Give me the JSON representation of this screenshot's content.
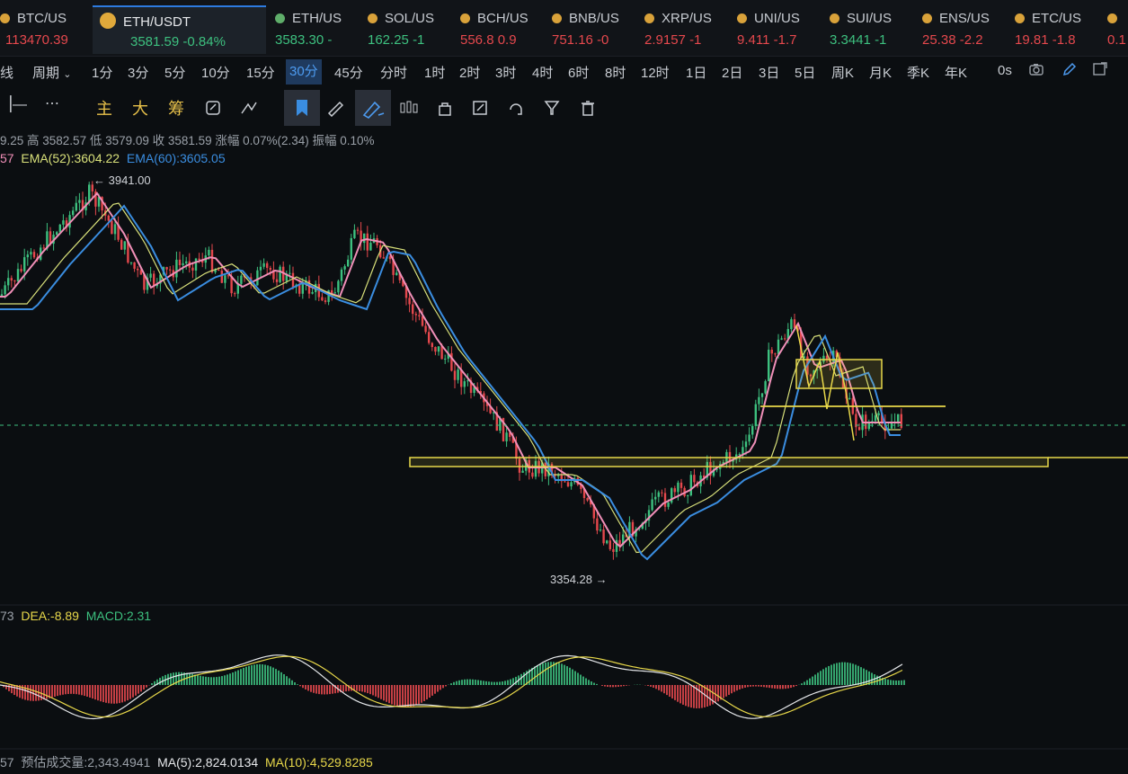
{
  "tickers": [
    {
      "symbol": "BTC/US",
      "price": "113470.39",
      "change": "",
      "dir": "down"
    },
    {
      "symbol": "ETH/USDT",
      "price": "3581.59",
      "change": "-0.84%",
      "dir": "up",
      "active": true
    },
    {
      "symbol": "ETH/US",
      "price": "3583.30",
      "change": "-",
      "dir": "up"
    },
    {
      "symbol": "SOL/US",
      "price": "162.25",
      "change": "-1",
      "dir": "up"
    },
    {
      "symbol": "BCH/US",
      "price": "556.8",
      "change": "0.9",
      "dir": "down"
    },
    {
      "symbol": "BNB/US",
      "price": "751.16",
      "change": "-0",
      "dir": "down"
    },
    {
      "symbol": "XRP/US",
      "price": "2.9157",
      "change": "-1",
      "dir": "down"
    },
    {
      "symbol": "UNI/US",
      "price": "9.411",
      "change": "-1.7",
      "dir": "down"
    },
    {
      "symbol": "SUI/US",
      "price": "3.3441",
      "change": "-1",
      "dir": "up"
    },
    {
      "symbol": "ENS/US",
      "price": "25.38",
      "change": "-2.2",
      "dir": "down"
    },
    {
      "symbol": "ETC/US",
      "price": "19.81",
      "change": "-1.8",
      "dir": "down"
    },
    {
      "symbol": "",
      "price": "0.1",
      "change": "",
      "dir": "down"
    }
  ],
  "periods": {
    "menu_prefix": "线",
    "period_label": "周期",
    "items": [
      "1分",
      "3分",
      "5分",
      "10分",
      "15分",
      "30分",
      "45分",
      "分时",
      "1时",
      "2时",
      "3时",
      "4时",
      "6时",
      "8时",
      "12时",
      "1日",
      "2日",
      "3日",
      "5日",
      "周K",
      "月K",
      "季K",
      "年K"
    ],
    "selected": "30分",
    "timezone": "0s"
  },
  "toolbar": {
    "main": "主",
    "big": "大",
    "chips": "筹"
  },
  "ohlc": {
    "text": "9.25  高 3582.57  低 3579.09  收 3581.59  涨幅 0.07%(2.34)  振幅 0.10%"
  },
  "ema": {
    "prefix": "57",
    "ema52": "EMA(52):3604.22",
    "ema60": "EMA(60):3605.05",
    "colors": {
      "ema_short": "#f08fb8",
      "ema52": "#d8e07a",
      "ema60": "#3a8de0"
    }
  },
  "annotations": {
    "high": "← 3941.00",
    "low": "3354.28 →"
  },
  "macd": {
    "prefix": "73",
    "dea": "DEA:-8.89",
    "macd": "MACD:2.31"
  },
  "volume": {
    "prefix": "57",
    "est": "预估成交量:2,343.4941",
    "ma5": "MA(5):2,824.0134",
    "ma10": "MA(10):4,529.8285"
  },
  "colors": {
    "up": "#3dc07f",
    "down": "#e5484d",
    "accent": "#2d7be0",
    "drawing": "#e8d84a"
  }
}
